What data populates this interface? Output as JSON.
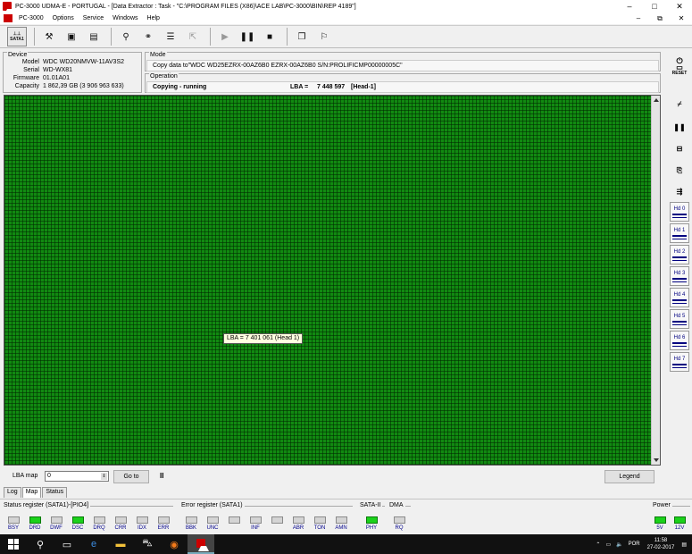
{
  "window": {
    "title": "PC-3000 UDMA-E - PORTUGAL - [Data Extractor : Task - \"C:\\PROGRAM FILES (X86)\\ACE LAB\\PC-3000\\BIN\\REP 4189\"]",
    "minimize": "–",
    "maximize": "□",
    "close": "✕"
  },
  "menu": {
    "items": [
      "PC-3000",
      "Options",
      "Service",
      "Windows",
      "Help"
    ],
    "mdi_min": "–",
    "mdi_restore": "⧉",
    "mdi_close": "✕"
  },
  "toolbar": {
    "sata_label": "SATA1",
    "icons": [
      "sata-icon",
      "tools-icon",
      "scroll-icon",
      "book-icon",
      "wrench-icon",
      "binoculars-icon",
      "stack-icon",
      "export-icon",
      "play-icon",
      "pause-icon",
      "stop-icon",
      "windows-icon",
      "exit-icon"
    ]
  },
  "device": {
    "label": "Device",
    "model_k": "Model",
    "model_v": "WDC WD20NMVW-11AV3S2",
    "serial_k": "Serial",
    "serial_v": "WD-WX81",
    "firmware_k": "Firmware",
    "firmware_v": "01.01A01",
    "capacity_k": "Capacity",
    "capacity_v": "1 862,39 GB (3 906 963 633)"
  },
  "mode": {
    "label": "Mode",
    "text": "Copy data to\"WDC WD25EZRX-00AZ6B0 EZRX-00AZ6B0 S/N:PROLIFICMP00000005C\""
  },
  "operation": {
    "label": "Operation",
    "status": "Copying - running",
    "lba_label": "LBA =",
    "lba_value": "7 448 597",
    "head": "[Head-1]"
  },
  "map": {
    "tooltip": "LBA =  7 401 061 (Head 1)"
  },
  "controls": {
    "lba_map_label": "LBA map",
    "lba_map_value": "0",
    "goto_label": "Go to",
    "pause_symbol": "II",
    "legend_label": "Legend"
  },
  "tabs": [
    "Log",
    "Map",
    "Status"
  ],
  "status_register": {
    "title": "Status register (SATA1)-[PIO4]",
    "bits": [
      {
        "name": "BSY",
        "on": false
      },
      {
        "name": "DRD",
        "on": true
      },
      {
        "name": "DWF",
        "on": false
      },
      {
        "name": "DSC",
        "on": true
      },
      {
        "name": "DRQ",
        "on": false
      },
      {
        "name": "CRR",
        "on": false
      },
      {
        "name": "IDX",
        "on": false
      },
      {
        "name": "ERR",
        "on": false
      }
    ]
  },
  "error_register": {
    "title": "Error register (SATA1)",
    "bits": [
      {
        "name": "BBK",
        "on": false
      },
      {
        "name": "UNC",
        "on": false
      },
      {
        "name": "",
        "on": false
      },
      {
        "name": "INF",
        "on": false
      },
      {
        "name": "",
        "on": false
      },
      {
        "name": "ABR",
        "on": false
      },
      {
        "name": "TON",
        "on": false
      },
      {
        "name": "AMN",
        "on": false
      }
    ]
  },
  "sata2": {
    "title": "SATA-II",
    "bit": "PHY"
  },
  "dma": {
    "title": "DMA",
    "bit": "RQ"
  },
  "power": {
    "title": "Power",
    "v5": "5V",
    "v12": "12V"
  },
  "side_panel": {
    "top_buttons": [
      "power-reset-icon",
      "tool-icon",
      "pause-icon",
      "drive-icon",
      "copy-icon",
      "heads-icon"
    ],
    "reset_label": "RESET",
    "heads": [
      "Hd 0",
      "Hd 1",
      "Hd 2",
      "Hd 3",
      "Hd 4",
      "Hd 5",
      "Hd 6",
      "Hd 7"
    ]
  },
  "taskbar": {
    "lang": "POR",
    "time": "11:58",
    "date": "27-02-2017"
  }
}
